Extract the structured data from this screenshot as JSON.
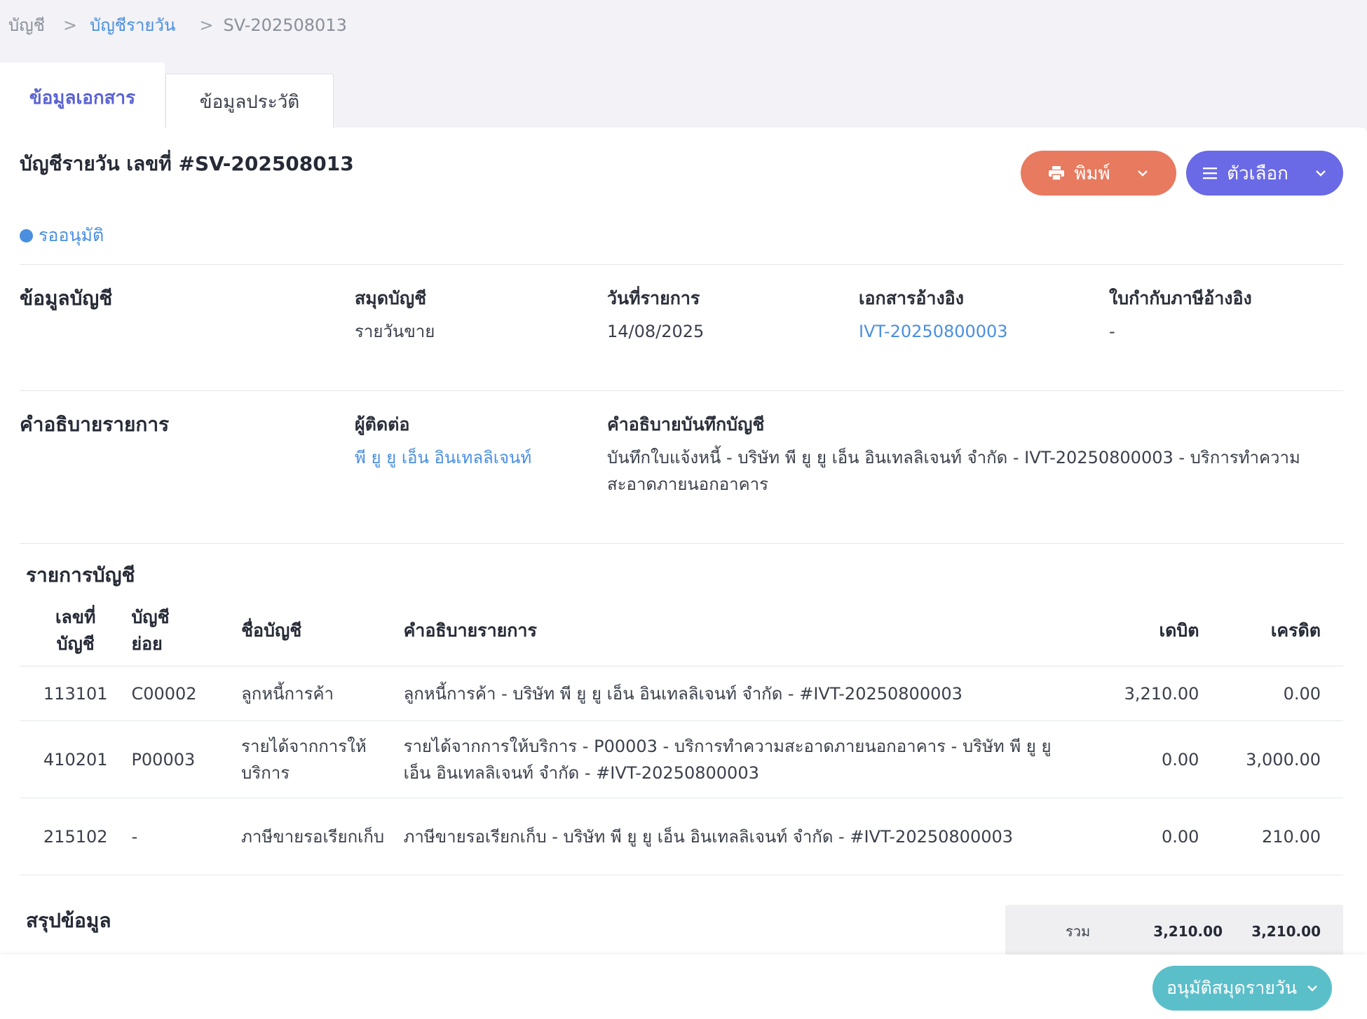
{
  "breadcrumb": {
    "root": "บัญชี",
    "separator": ">",
    "section": "บัญชีรายวัน",
    "current": "SV-202508013"
  },
  "tabs": {
    "active": "ข้อมูลเอกสาร",
    "inactive": "ข้อมูลประวัติ"
  },
  "header": {
    "title": "บัญชีรายวัน เลขที่ #SV-202508013",
    "print_label": "พิมพ์",
    "options_label": "ตัวเลือก",
    "status": "รออนุมัติ"
  },
  "account_info": {
    "heading": "ข้อมูลบัญชี",
    "journal_label": "สมุดบัญชี",
    "journal_value": "รายวันขาย",
    "date_label": "วันที่รายการ",
    "date_value": "14/08/2025",
    "ref_doc_label": "เอกสารอ้างอิง",
    "ref_doc_value": "IVT-20250800003",
    "tax_invoice_label": "ใบกำกับภาษีอ้างอิง",
    "tax_invoice_value": "-"
  },
  "description": {
    "heading": "คำอธิบายรายการ",
    "contact_label": "ผู้ติดต่อ",
    "contact_value": "พี ยู ยู เอ็น อินเทลลิเจนท์",
    "memo_label": "คำอธิบายบันทึกบัญชี",
    "memo_value": "บันทึกใบแจ้งหนี้ - บริษัท พี ยู ยู เอ็น อินเทลลิเจนท์ จำกัด - IVT-20250800003 - บริการทำความสะอาดภายนอกอาคาร"
  },
  "ledger": {
    "heading": "รายการบัญชี",
    "columns": {
      "account_no_line1": "เลขที่",
      "account_no_line2": "บัญชี",
      "sub_account_line1": "บัญชี",
      "sub_account_line2": "ย่อย",
      "account_name": "ชื่อบัญชี",
      "description": "คำอธิบายรายการ",
      "debit": "เดบิต",
      "credit": "เครดิต"
    },
    "rows": [
      {
        "account_no": "113101",
        "sub_account": "C00002",
        "account_name": "ลูกหนี้การค้า",
        "description": "ลูกหนี้การค้า - บริษัท พี ยู ยู เอ็น อินเทลลิเจนท์ จำกัด - #IVT-20250800003",
        "debit": "3,210.00",
        "credit": "0.00"
      },
      {
        "account_no": "410201",
        "sub_account": "P00003",
        "account_name": "รายได้จากการให้บริการ",
        "description": "รายได้จากการให้บริการ - P00003 - บริการทำความสะอาดภายนอกอาคาร - บริษัท พี ยู ยู เอ็น อินเทลลิเจนท์ จำกัด - #IVT-20250800003",
        "debit": "0.00",
        "credit": "3,000.00"
      },
      {
        "account_no": "215102",
        "sub_account": "-",
        "account_name": "ภาษีขายรอเรียกเก็บ",
        "description": "ภาษีขายรอเรียกเก็บ - บริษัท พี ยู ยู เอ็น อินเทลลิเจนท์ จำกัด - #IVT-20250800003",
        "debit": "0.00",
        "credit": "210.00"
      }
    ]
  },
  "summary": {
    "heading": "สรุปข้อมูล",
    "total_label": "รวม",
    "total_debit": "3,210.00",
    "total_credit": "3,210.00"
  },
  "footer": {
    "approve_label": "อนุมัติสมุดรายวัน"
  },
  "colors": {
    "print_button": "#e77a5f",
    "options_button": "#6a69e6",
    "approve_button": "#5bbfca",
    "link": "#4a8fe0",
    "active_tab": "#5b63d3"
  },
  "icons": [
    "printer-icon",
    "chevron-down-icon",
    "menu-icon"
  ]
}
